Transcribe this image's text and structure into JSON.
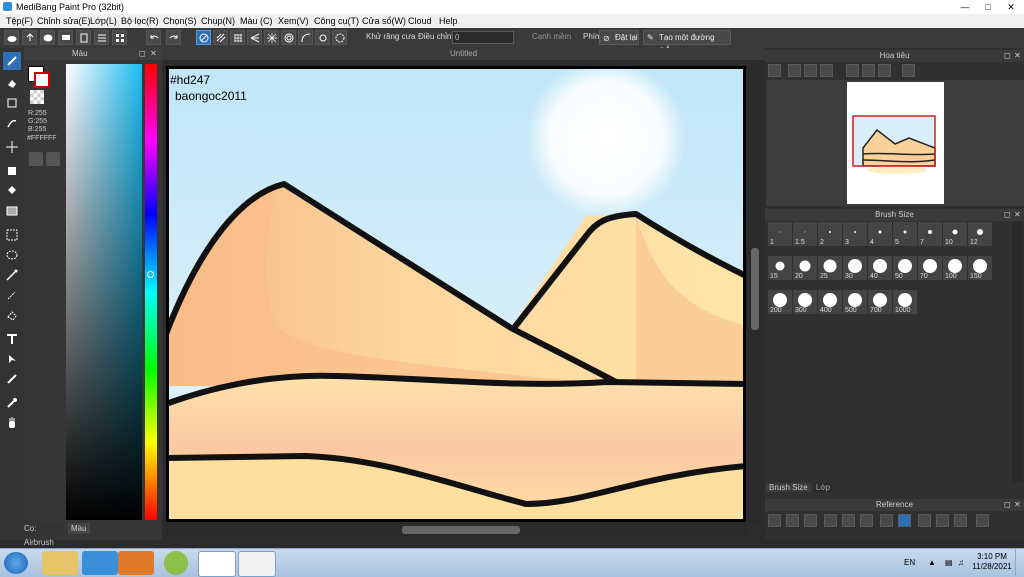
{
  "window": {
    "title": "MediBang Paint Pro (32bit)"
  },
  "menu": [
    "Tệp(F)",
    "Chỉnh sửa(E)",
    "Lớp(L)",
    "Bộ lọc(R)",
    "Chọn(S)",
    "Chụp(N)",
    "Màu (C)",
    "Xem(V)",
    "Công cụ(T)",
    "Cửa sổ(W)",
    "Cloud",
    "Help"
  ],
  "toolbar": {
    "antialias_label": "Khử răng cưa",
    "adjust_label": "Điều chỉnh",
    "adjust_value": "0",
    "smooth_label": "Cạnh mềm",
    "key_label": "Phím",
    "reset_label": "Đặt lại",
    "ruler_label": "Tạo một đường thẳng"
  },
  "color_panel": {
    "title": "Màu",
    "r": "R:255",
    "g": "G:255",
    "b": "B:255",
    "hex": "#FFFFFF",
    "foreground": "#ffffff",
    "background": "#cc0000"
  },
  "document": {
    "tab_title": "Untitled"
  },
  "artwork": {
    "text_line1": "#hd247",
    "text_line2": "baongoc2011"
  },
  "navigator": {
    "title": "Hoa tiêu"
  },
  "brush_size": {
    "title": "Brush Size",
    "sizes": [
      "1",
      "1.5",
      "2",
      "3",
      "4",
      "5",
      "7",
      "10",
      "12",
      "15",
      "20",
      "25",
      "30",
      "40",
      "50",
      "70",
      "100",
      "150",
      "200",
      "300",
      "400",
      "500",
      "700",
      "1000"
    ]
  },
  "right_tabs": {
    "brush": "Brush Size",
    "layer": "Lớp"
  },
  "reference": {
    "title": "Reference"
  },
  "status": {
    "tool": "Cọ: Airbrush",
    "tab": "Màu"
  },
  "taskbar": {
    "lang": "EN",
    "time": "3:10 PM",
    "date": "11/28/2021"
  }
}
